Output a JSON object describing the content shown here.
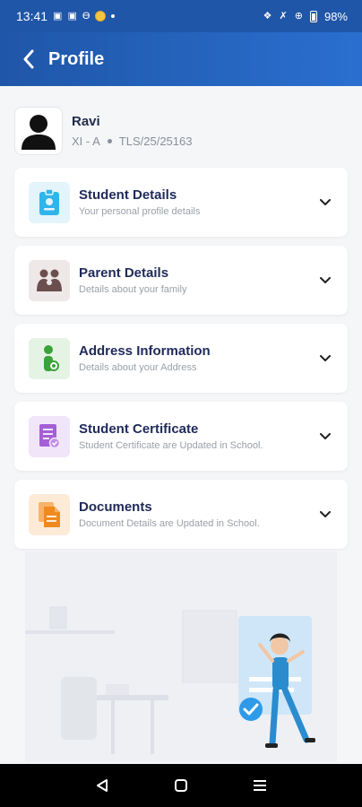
{
  "status": {
    "time": "13:41",
    "battery": "98%"
  },
  "header": {
    "title": "Profile"
  },
  "profile": {
    "name": "Ravi",
    "class": "XI - A",
    "id": "TLS/25/25163"
  },
  "cards": [
    {
      "title": "Student Details",
      "subtitle": "Your personal profile details",
      "icon": "id-card-icon",
      "color": "#2fb4ec",
      "bg": "#e3f4fb"
    },
    {
      "title": "Parent Details",
      "subtitle": "Details about your family",
      "icon": "family-icon",
      "color": "#6b4f4f",
      "bg": "#efe8e8"
    },
    {
      "title": "Address Information",
      "subtitle": "Details about your Address",
      "icon": "location-person-icon",
      "color": "#3aa33a",
      "bg": "#e5f3e5"
    },
    {
      "title": "Student Certificate",
      "subtitle": "Student Certificate are Updated in School.",
      "icon": "certificate-icon",
      "color": "#a45fd6",
      "bg": "#f1e6f9"
    },
    {
      "title": "Documents",
      "subtitle": "Document Details are Updated in School.",
      "icon": "documents-icon",
      "color": "#f08a1e",
      "bg": "#fdebd8"
    }
  ]
}
